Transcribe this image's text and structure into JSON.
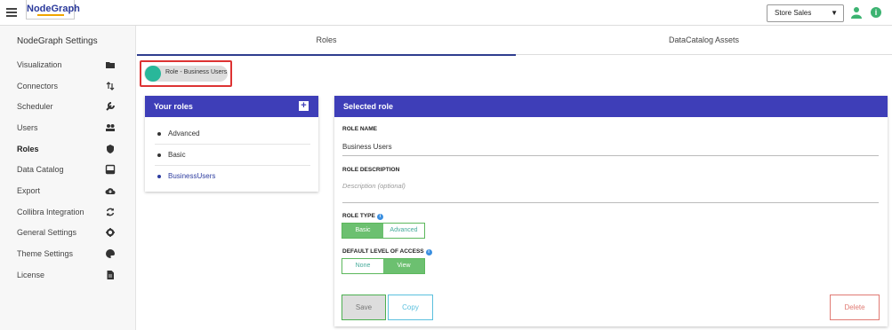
{
  "app": {
    "logo_text": "NodeGraph"
  },
  "topbar": {
    "store_select_value": "Store Sales"
  },
  "sidebar": {
    "title": "NodeGraph Settings",
    "items": [
      {
        "label": "Visualization",
        "icon": "folder-icon"
      },
      {
        "label": "Connectors",
        "icon": "connector-arrows-icon"
      },
      {
        "label": "Scheduler",
        "icon": "wrench-icon"
      },
      {
        "label": "Users",
        "icon": "users-icon"
      },
      {
        "label": "Roles",
        "icon": "shield-icon",
        "active": true
      },
      {
        "label": "Data Catalog",
        "icon": "inbox-icon"
      },
      {
        "label": "Export",
        "icon": "cloud-download-icon"
      },
      {
        "label": "Collibra Integration",
        "icon": "sync-icon"
      },
      {
        "label": "General Settings",
        "icon": "gear-icon"
      },
      {
        "label": "Theme Settings",
        "icon": "palette-icon"
      },
      {
        "label": "License",
        "icon": "document-icon"
      }
    ]
  },
  "tabs": [
    {
      "label": "Roles",
      "active": true
    },
    {
      "label": "DataCatalog Assets",
      "active": false
    }
  ],
  "chip": {
    "label": "Role - Business Users"
  },
  "your_roles": {
    "title": "Your roles",
    "items": [
      {
        "label": "Advanced"
      },
      {
        "label": "Basic"
      },
      {
        "label": "BusinessUsers",
        "selected": true
      }
    ]
  },
  "selected_role": {
    "title": "Selected role",
    "role_name_label": "ROLE NAME",
    "role_name_value": "Business Users",
    "role_description_label": "ROLE DESCRIPTION",
    "role_description_placeholder": "Description (optional)",
    "role_type_label": "ROLE TYPE",
    "role_type_options": [
      "Basic",
      "Advanced"
    ],
    "role_type_selected": "Basic",
    "access_label": "DEFAULT LEVEL OF ACCESS",
    "access_options": [
      "None",
      "View"
    ],
    "access_selected": "View",
    "save_label": "Save",
    "copy_label": "Copy",
    "delete_label": "Delete"
  },
  "colors": {
    "header_blue": "#3e3eb8",
    "accent_green": "#6cc070",
    "chip_teal": "#29b79a",
    "highlight_red": "#dd3333"
  }
}
